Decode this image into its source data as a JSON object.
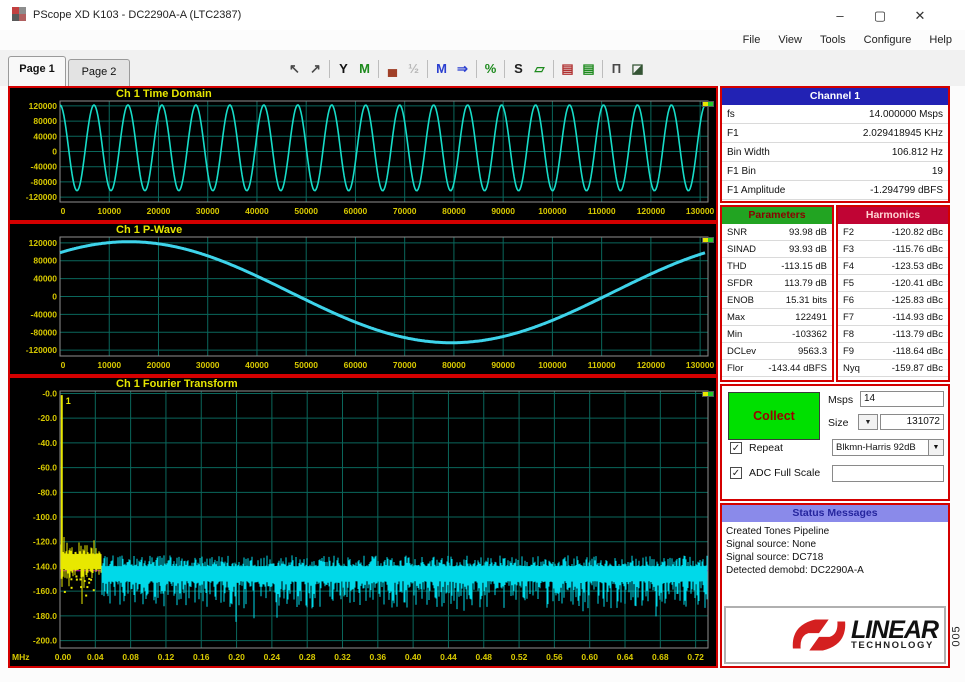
{
  "window": {
    "title": "PScope XD K103 - DC2290A-A (LTC2387)",
    "controls": {
      "minimize": "–",
      "maximize": "▢",
      "close": "✕"
    }
  },
  "menu": {
    "items": [
      "File",
      "View",
      "Tools",
      "Configure",
      "Help"
    ]
  },
  "tabs": [
    {
      "label": "Page 1",
      "active": true
    },
    {
      "label": "Page 2",
      "active": false
    }
  ],
  "toolbar": {
    "groups": [
      [
        {
          "name": "pan-tool-icon",
          "glyph": "↖",
          "color": "#4a4a4a"
        },
        {
          "name": "zoom-tool-icon",
          "glyph": "↗",
          "color": "#4a4a4a"
        }
      ],
      [
        {
          "name": "y-scale-icon",
          "glyph": "Y",
          "color": "#111111"
        },
        {
          "name": "window-filter-icon",
          "glyph": "M",
          "color": "#1d8a1d"
        }
      ],
      [
        {
          "name": "histogram-icon",
          "glyph": "▄",
          "color": "#a04028"
        },
        {
          "name": "scale-toggle-icon",
          "glyph": "½",
          "color": "#b8b8b8"
        }
      ],
      [
        {
          "name": "average-icon",
          "glyph": "M",
          "color": "#2b3fd0"
        },
        {
          "name": "continuous-avg-icon",
          "glyph": "⇒",
          "color": "#2b3fd0"
        }
      ],
      [
        {
          "name": "nodes-icon",
          "glyph": "%",
          "color": "#1d8a1d"
        }
      ],
      [
        {
          "name": "s-curve-icon",
          "glyph": "S",
          "color": "#222222"
        },
        {
          "name": "polygon-icon",
          "glyph": "▱",
          "color": "#1d8a1d"
        }
      ],
      [
        {
          "name": "bars-red-icon",
          "glyph": "▤",
          "color": "#b03030"
        },
        {
          "name": "bars-green-icon",
          "glyph": "▤",
          "color": "#1d8a1d"
        }
      ],
      [
        {
          "name": "pulse-icon",
          "glyph": "Π",
          "color": "#4a4a4a"
        },
        {
          "name": "export-image-icon",
          "glyph": "◪",
          "color": "#355535"
        }
      ]
    ]
  },
  "channel_panel": {
    "title": "Channel 1",
    "rows": [
      {
        "label": "fs",
        "value": "14.000000 Msps"
      },
      {
        "label": "F1",
        "value": "2.029418945 KHz"
      },
      {
        "label": "Bin Width",
        "value": "106.812 Hz"
      },
      {
        "label": "F1 Bin",
        "value": "19"
      },
      {
        "label": "F1 Amplitude",
        "value": "-1.294799 dBFS"
      }
    ]
  },
  "parameters_panel": {
    "title": "Parameters",
    "rows": [
      {
        "label": "SNR",
        "value": "93.98 dB"
      },
      {
        "label": "SINAD",
        "value": "93.93 dB"
      },
      {
        "label": "THD",
        "value": "-113.15 dB"
      },
      {
        "label": "SFDR",
        "value": "113.79 dB"
      },
      {
        "label": "ENOB",
        "value": "15.31 bits"
      },
      {
        "label": "Max",
        "value": "122491"
      },
      {
        "label": "Min",
        "value": "-103362"
      },
      {
        "label": "DCLev",
        "value": "9563.3"
      },
      {
        "label": "Flor",
        "value": "-143.44 dBFS"
      }
    ]
  },
  "harmonics_panel": {
    "title": "Harmonics",
    "rows": [
      {
        "label": "F2",
        "value": "-120.82 dBc"
      },
      {
        "label": "F3",
        "value": "-115.76 dBc"
      },
      {
        "label": "F4",
        "value": "-123.53 dBc"
      },
      {
        "label": "F5",
        "value": "-120.41 dBc"
      },
      {
        "label": "F6",
        "value": "-125.83 dBc"
      },
      {
        "label": "F7",
        "value": "-114.93 dBc"
      },
      {
        "label": "F8",
        "value": "-113.79 dBc"
      },
      {
        "label": "F9",
        "value": "-118.64 dBc"
      },
      {
        "label": "Nyq",
        "value": "-159.87 dBc"
      }
    ]
  },
  "collect_panel": {
    "collect_label": "Collect",
    "msps_label": "Msps",
    "msps_value": "14",
    "size_label": "Size",
    "size_value": "131072",
    "repeat_label": "Repeat",
    "repeat_checked": "✓",
    "window_value": "Blkmn-Harris 92dB",
    "adc_label": "ADC Full Scale",
    "adc_checked": "✓",
    "adc_value": ""
  },
  "status_panel": {
    "title": "Status Messages",
    "lines": [
      "Created Tones Pipeline",
      "Signal source: None",
      "Signal source: DC718",
      "Detected demobd: DC2290A-A"
    ]
  },
  "logo": {
    "line1": "LINEAR",
    "line2": "TECHNOLOGY"
  },
  "figure_label": "005",
  "chart_data": [
    {
      "type": "line",
      "title": "Ch 1 Time Domain",
      "xlim": [
        0,
        131600
      ],
      "ylim": [
        -133000,
        133000
      ],
      "x_ticks": [
        0,
        10000,
        20000,
        30000,
        40000,
        50000,
        60000,
        70000,
        80000,
        90000,
        100000,
        110000,
        120000,
        130000
      ],
      "x_tick_labels": [
        "0",
        "10000",
        "20000",
        "30000",
        "40000",
        "50000",
        "60000",
        "70000",
        "80000",
        "90000",
        "100000",
        "110000",
        "120000",
        "130000"
      ],
      "y_ticks": [
        120000,
        80000,
        40000,
        0,
        -40000,
        -80000,
        -120000
      ],
      "y_tick_labels": [
        "120000",
        "80000",
        "40000",
        "0",
        "-40000",
        "-80000",
        "-120000"
      ],
      "signal": {
        "kind": "sine",
        "cycles": 19,
        "amplitude": 112926,
        "dc_offset": 9563,
        "peak_x": 0,
        "record_length": 131072
      },
      "line_color": "#16dcc8",
      "line_width": 1.6,
      "grid_color": "#0a675c",
      "label_color": "#d8c900"
    },
    {
      "type": "line",
      "title": "Ch 1 P-Wave",
      "xlim": [
        0,
        131600
      ],
      "ylim": [
        -133000,
        133000
      ],
      "x_ticks": [
        0,
        10000,
        20000,
        30000,
        40000,
        50000,
        60000,
        70000,
        80000,
        90000,
        100000,
        110000,
        120000,
        130000
      ],
      "x_tick_labels": [
        "0",
        "10000",
        "20000",
        "30000",
        "40000",
        "50000",
        "60000",
        "70000",
        "80000",
        "90000",
        "100000",
        "110000",
        "120000",
        "130000"
      ],
      "y_ticks": [
        120000,
        80000,
        40000,
        0,
        -40000,
        -80000,
        -120000
      ],
      "y_tick_labels": [
        "120000",
        "80000",
        "40000",
        "0",
        "-40000",
        "-80000",
        "-120000"
      ],
      "signal": {
        "kind": "sine",
        "cycles": 1,
        "amplitude": 112926,
        "dc_offset": 9563,
        "peak_x": 14000,
        "record_length": 131072
      },
      "line_color": "#3ed3ea",
      "line_width": 3,
      "grid_color": "#0a675c",
      "label_color": "#d8c900"
    },
    {
      "type": "line",
      "title": "Ch 1 Fourier Transform",
      "x_unit": "MHz",
      "xlim": [
        0,
        0.734
      ],
      "ylim": [
        -206,
        2
      ],
      "x_ticks": [
        0,
        0.04,
        0.08,
        0.12,
        0.16,
        0.2,
        0.24,
        0.28,
        0.32,
        0.36,
        0.4,
        0.44,
        0.48,
        0.52,
        0.56,
        0.6,
        0.64,
        0.68,
        0.72
      ],
      "x_tick_labels": [
        "0.00",
        "0.04",
        "0.08",
        "0.12",
        "0.16",
        "0.20",
        "0.24",
        "0.28",
        "0.32",
        "0.36",
        "0.40",
        "0.44",
        "0.48",
        "0.52",
        "0.56",
        "0.60",
        "0.64",
        "0.68",
        "0.72"
      ],
      "y_ticks": [
        0,
        -20,
        -40,
        -60,
        -80,
        -100,
        -120,
        -140,
        -160,
        -180,
        -200
      ],
      "y_tick_labels": [
        "-0.0",
        "-20.0",
        "-40.0",
        "-60.0",
        "-80.0",
        "-100.0",
        "-120.0",
        "-140.0",
        "-160.0",
        "-180.0",
        "-200.0"
      ],
      "fft": {
        "fundamental": {
          "x_mhz": 0.002,
          "peak_db": -1.294799,
          "marker_label": "1"
        },
        "noise_floor_db": -143.44,
        "yellow_max_mhz": 0.047,
        "yellow_center_db": -136,
        "cyan_center_db": -146,
        "colors": {
          "noise": "#00d9e9",
          "low_freq": "#e8e800",
          "floor_line": "#c000c0"
        }
      },
      "grid_color": "#0a675c",
      "label_color": "#d8c900"
    }
  ]
}
